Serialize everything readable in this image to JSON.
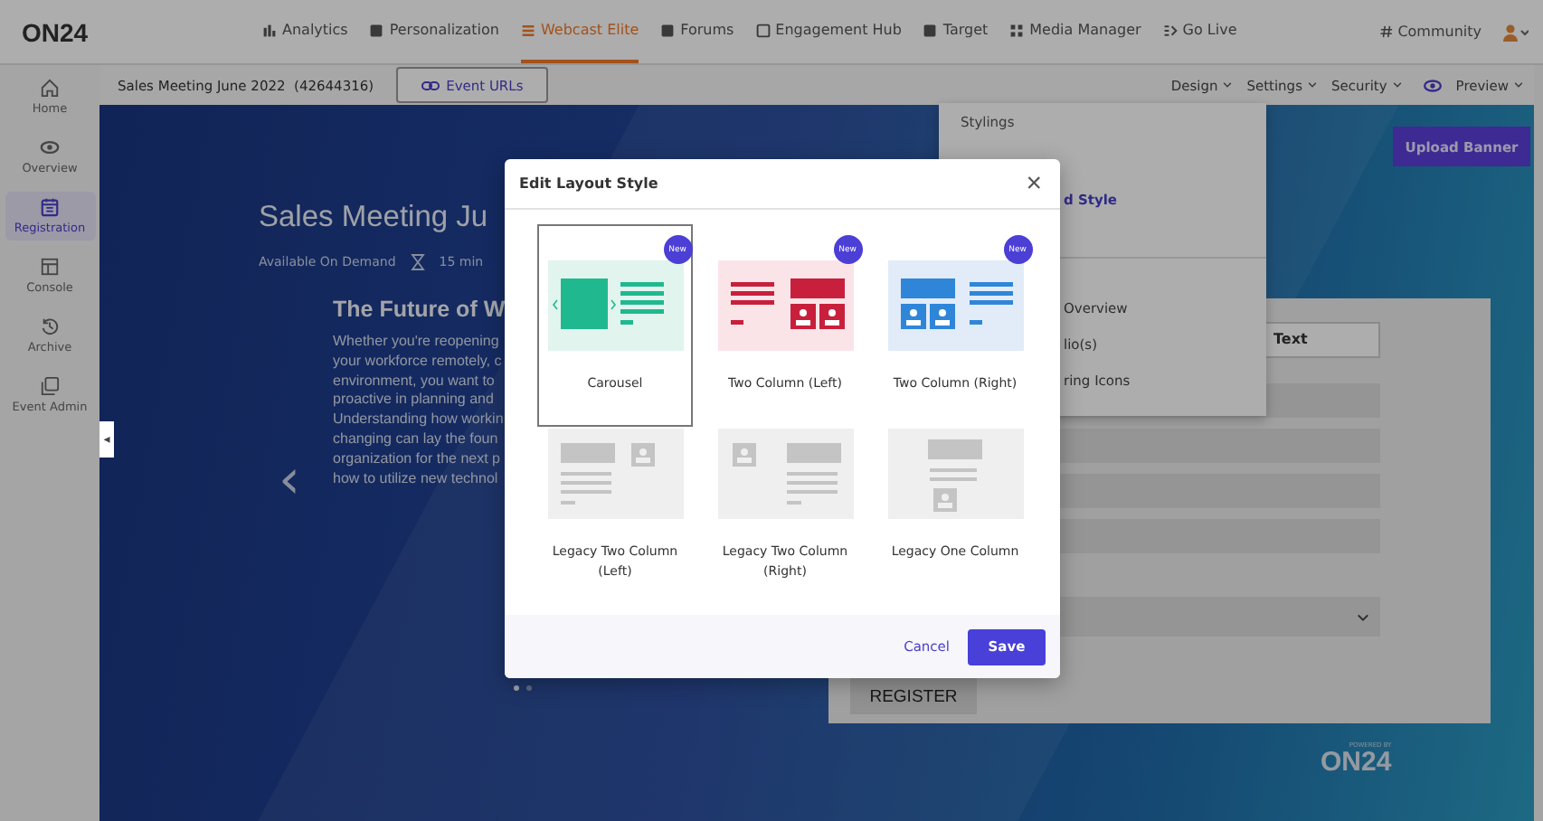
{
  "top_nav": {
    "logo": "ON24",
    "items": [
      {
        "label": "Analytics",
        "selected": false
      },
      {
        "label": "Personalization",
        "selected": false
      },
      {
        "label": "Webcast Elite",
        "selected": true
      },
      {
        "label": "Forums",
        "selected": false
      },
      {
        "label": "Engagement Hub",
        "selected": false
      },
      {
        "label": "Target",
        "selected": false
      },
      {
        "label": "Media Manager",
        "selected": false
      },
      {
        "label": "Go Live",
        "selected": false
      }
    ],
    "community": "Community"
  },
  "sidebar": {
    "items": [
      {
        "label": "Home",
        "selected": false
      },
      {
        "label": "Overview",
        "selected": false
      },
      {
        "label": "Registration",
        "selected": true
      },
      {
        "label": "Console",
        "selected": false
      },
      {
        "label": "Archive",
        "selected": false
      },
      {
        "label": "Event Admin",
        "selected": false
      }
    ],
    "collapse": "◂"
  },
  "sub_bar": {
    "event": "Sales Meeting June 2022  (42644316)",
    "event_urls": "Event URLs",
    "menus": [
      {
        "kind": "menu",
        "label": "Design"
      },
      {
        "kind": "menu",
        "label": "Settings"
      },
      {
        "kind": "menu",
        "label": "Security"
      },
      {
        "kind": "preview",
        "label": "Preview"
      }
    ]
  },
  "design_menu": {
    "items": [
      {
        "kind": "heading",
        "label": "Stylings"
      },
      {
        "kind": "link",
        "label": "d Style"
      },
      {
        "kind": "divider"
      },
      {
        "kind": "item",
        "label": "Overview"
      },
      {
        "kind": "item",
        "label": "lio(s)"
      },
      {
        "kind": "item",
        "label": "ring Icons"
      }
    ]
  },
  "banner": {
    "title": "Sales Meeting Ju",
    "availability": "Available On Demand",
    "duration": "15 min",
    "heading": "The Future of W",
    "paragraph_lines": [
      "Whether you're reopening",
      "your workforce remotely, c",
      "environment, you want to",
      "proactive in planning and",
      "Understanding how workin",
      "changing can lay the foun",
      "organization for the next p",
      "how to utilize new technol"
    ],
    "prev": "‹",
    "slides": [
      {
        "selected": true
      },
      {
        "selected": false
      }
    ],
    "upload_banner": "Upload Banner",
    "powered_by": "POWERED BY",
    "footer_logo": "ON24"
  },
  "registration_form": {
    "text_field": "Text",
    "button": "REGISTER"
  },
  "modal": {
    "title": "Edit Layout Style",
    "close": "×",
    "options": [
      {
        "kind": "carousel",
        "label": "Carousel",
        "color": "#20b98f",
        "badge": "New",
        "selected": true
      },
      {
        "kind": "two-left",
        "label": "Two Column (Left)",
        "color": "#c8203c",
        "badge": "New",
        "selected": false
      },
      {
        "kind": "two-right",
        "label": "Two Column (Right)",
        "color": "#2f86d9",
        "badge": "New",
        "selected": false
      },
      {
        "kind": "legacy-left",
        "label": "Legacy Two Column (Left)",
        "color": "#c4c4c4",
        "selected": false
      },
      {
        "kind": "legacy-right",
        "label": "Legacy Two Column (Right)",
        "color": "#c4c4c4",
        "selected": false
      },
      {
        "kind": "legacy-one",
        "label": "Legacy One Column",
        "color": "#c4c4c4",
        "selected": false
      }
    ],
    "cancel": "Cancel",
    "save": "Save"
  }
}
